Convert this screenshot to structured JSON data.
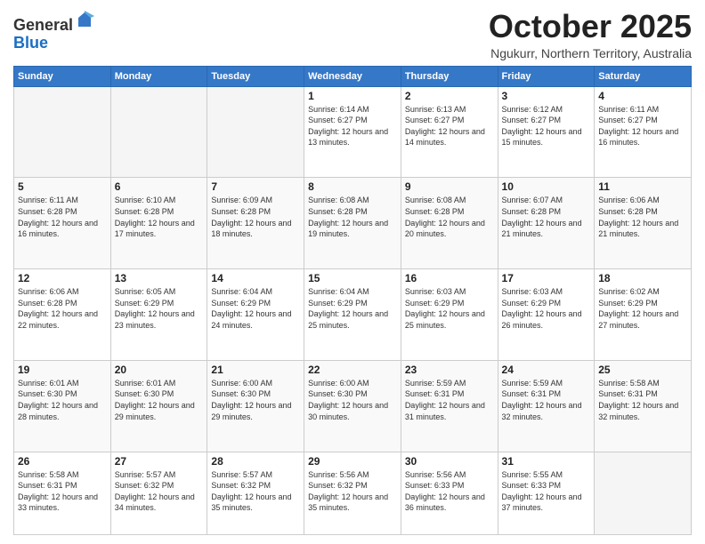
{
  "header": {
    "logo_general": "General",
    "logo_blue": "Blue",
    "month_title": "October 2025",
    "location": "Ngukurr, Northern Territory, Australia"
  },
  "weekdays": [
    "Sunday",
    "Monday",
    "Tuesday",
    "Wednesday",
    "Thursday",
    "Friday",
    "Saturday"
  ],
  "weeks": [
    [
      {
        "day": "",
        "sunrise": "",
        "sunset": "",
        "daylight": ""
      },
      {
        "day": "",
        "sunrise": "",
        "sunset": "",
        "daylight": ""
      },
      {
        "day": "",
        "sunrise": "",
        "sunset": "",
        "daylight": ""
      },
      {
        "day": "1",
        "sunrise": "Sunrise: 6:14 AM",
        "sunset": "Sunset: 6:27 PM",
        "daylight": "Daylight: 12 hours and 13 minutes."
      },
      {
        "day": "2",
        "sunrise": "Sunrise: 6:13 AM",
        "sunset": "Sunset: 6:27 PM",
        "daylight": "Daylight: 12 hours and 14 minutes."
      },
      {
        "day": "3",
        "sunrise": "Sunrise: 6:12 AM",
        "sunset": "Sunset: 6:27 PM",
        "daylight": "Daylight: 12 hours and 15 minutes."
      },
      {
        "day": "4",
        "sunrise": "Sunrise: 6:11 AM",
        "sunset": "Sunset: 6:27 PM",
        "daylight": "Daylight: 12 hours and 16 minutes."
      }
    ],
    [
      {
        "day": "5",
        "sunrise": "Sunrise: 6:11 AM",
        "sunset": "Sunset: 6:28 PM",
        "daylight": "Daylight: 12 hours and 16 minutes."
      },
      {
        "day": "6",
        "sunrise": "Sunrise: 6:10 AM",
        "sunset": "Sunset: 6:28 PM",
        "daylight": "Daylight: 12 hours and 17 minutes."
      },
      {
        "day": "7",
        "sunrise": "Sunrise: 6:09 AM",
        "sunset": "Sunset: 6:28 PM",
        "daylight": "Daylight: 12 hours and 18 minutes."
      },
      {
        "day": "8",
        "sunrise": "Sunrise: 6:08 AM",
        "sunset": "Sunset: 6:28 PM",
        "daylight": "Daylight: 12 hours and 19 minutes."
      },
      {
        "day": "9",
        "sunrise": "Sunrise: 6:08 AM",
        "sunset": "Sunset: 6:28 PM",
        "daylight": "Daylight: 12 hours and 20 minutes."
      },
      {
        "day": "10",
        "sunrise": "Sunrise: 6:07 AM",
        "sunset": "Sunset: 6:28 PM",
        "daylight": "Daylight: 12 hours and 21 minutes."
      },
      {
        "day": "11",
        "sunrise": "Sunrise: 6:06 AM",
        "sunset": "Sunset: 6:28 PM",
        "daylight": "Daylight: 12 hours and 21 minutes."
      }
    ],
    [
      {
        "day": "12",
        "sunrise": "Sunrise: 6:06 AM",
        "sunset": "Sunset: 6:28 PM",
        "daylight": "Daylight: 12 hours and 22 minutes."
      },
      {
        "day": "13",
        "sunrise": "Sunrise: 6:05 AM",
        "sunset": "Sunset: 6:29 PM",
        "daylight": "Daylight: 12 hours and 23 minutes."
      },
      {
        "day": "14",
        "sunrise": "Sunrise: 6:04 AM",
        "sunset": "Sunset: 6:29 PM",
        "daylight": "Daylight: 12 hours and 24 minutes."
      },
      {
        "day": "15",
        "sunrise": "Sunrise: 6:04 AM",
        "sunset": "Sunset: 6:29 PM",
        "daylight": "Daylight: 12 hours and 25 minutes."
      },
      {
        "day": "16",
        "sunrise": "Sunrise: 6:03 AM",
        "sunset": "Sunset: 6:29 PM",
        "daylight": "Daylight: 12 hours and 25 minutes."
      },
      {
        "day": "17",
        "sunrise": "Sunrise: 6:03 AM",
        "sunset": "Sunset: 6:29 PM",
        "daylight": "Daylight: 12 hours and 26 minutes."
      },
      {
        "day": "18",
        "sunrise": "Sunrise: 6:02 AM",
        "sunset": "Sunset: 6:29 PM",
        "daylight": "Daylight: 12 hours and 27 minutes."
      }
    ],
    [
      {
        "day": "19",
        "sunrise": "Sunrise: 6:01 AM",
        "sunset": "Sunset: 6:30 PM",
        "daylight": "Daylight: 12 hours and 28 minutes."
      },
      {
        "day": "20",
        "sunrise": "Sunrise: 6:01 AM",
        "sunset": "Sunset: 6:30 PM",
        "daylight": "Daylight: 12 hours and 29 minutes."
      },
      {
        "day": "21",
        "sunrise": "Sunrise: 6:00 AM",
        "sunset": "Sunset: 6:30 PM",
        "daylight": "Daylight: 12 hours and 29 minutes."
      },
      {
        "day": "22",
        "sunrise": "Sunrise: 6:00 AM",
        "sunset": "Sunset: 6:30 PM",
        "daylight": "Daylight: 12 hours and 30 minutes."
      },
      {
        "day": "23",
        "sunrise": "Sunrise: 5:59 AM",
        "sunset": "Sunset: 6:31 PM",
        "daylight": "Daylight: 12 hours and 31 minutes."
      },
      {
        "day": "24",
        "sunrise": "Sunrise: 5:59 AM",
        "sunset": "Sunset: 6:31 PM",
        "daylight": "Daylight: 12 hours and 32 minutes."
      },
      {
        "day": "25",
        "sunrise": "Sunrise: 5:58 AM",
        "sunset": "Sunset: 6:31 PM",
        "daylight": "Daylight: 12 hours and 32 minutes."
      }
    ],
    [
      {
        "day": "26",
        "sunrise": "Sunrise: 5:58 AM",
        "sunset": "Sunset: 6:31 PM",
        "daylight": "Daylight: 12 hours and 33 minutes."
      },
      {
        "day": "27",
        "sunrise": "Sunrise: 5:57 AM",
        "sunset": "Sunset: 6:32 PM",
        "daylight": "Daylight: 12 hours and 34 minutes."
      },
      {
        "day": "28",
        "sunrise": "Sunrise: 5:57 AM",
        "sunset": "Sunset: 6:32 PM",
        "daylight": "Daylight: 12 hours and 35 minutes."
      },
      {
        "day": "29",
        "sunrise": "Sunrise: 5:56 AM",
        "sunset": "Sunset: 6:32 PM",
        "daylight": "Daylight: 12 hours and 35 minutes."
      },
      {
        "day": "30",
        "sunrise": "Sunrise: 5:56 AM",
        "sunset": "Sunset: 6:33 PM",
        "daylight": "Daylight: 12 hours and 36 minutes."
      },
      {
        "day": "31",
        "sunrise": "Sunrise: 5:55 AM",
        "sunset": "Sunset: 6:33 PM",
        "daylight": "Daylight: 12 hours and 37 minutes."
      },
      {
        "day": "",
        "sunrise": "",
        "sunset": "",
        "daylight": ""
      }
    ]
  ]
}
